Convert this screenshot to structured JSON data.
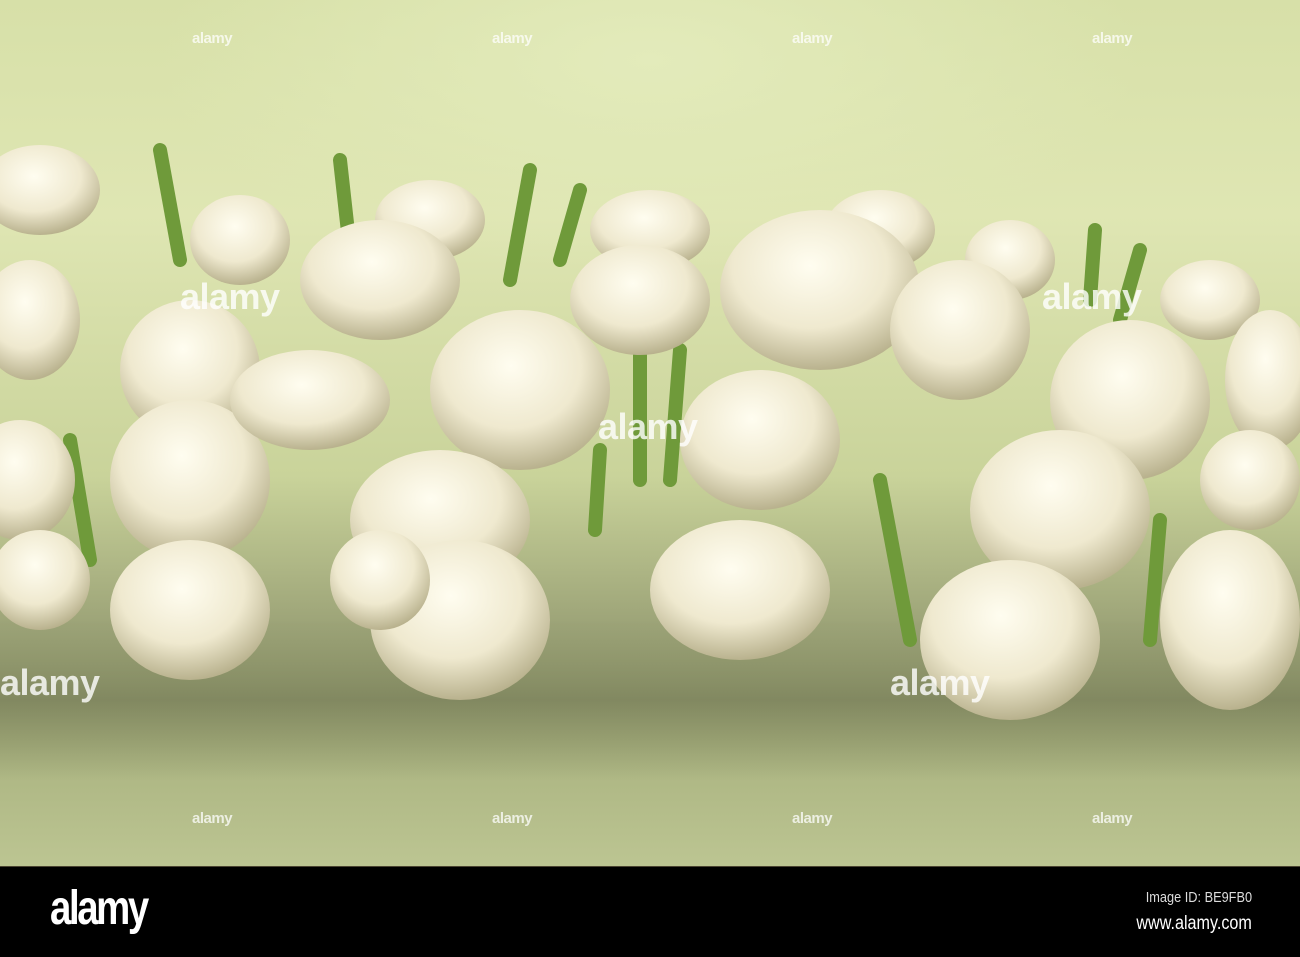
{
  "photo": {
    "subject": "jasmine-garland",
    "watermark_text": "alamy",
    "colors": {
      "fabric": "#d7e0a8",
      "flower": "#f3efd9",
      "stem": "#6f9a3a"
    }
  },
  "footer": {
    "logo": "alamy",
    "image_id": "Image ID: BE9FB0",
    "website": "www.alamy.com"
  }
}
